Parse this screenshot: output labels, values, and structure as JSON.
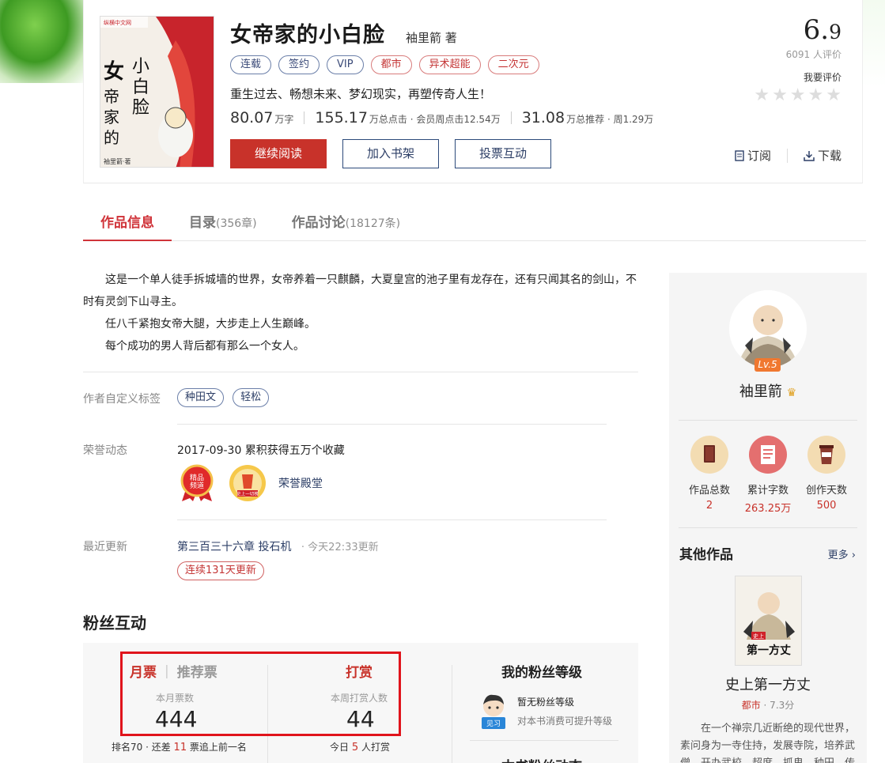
{
  "book": {
    "title": "女帝家的小白脸",
    "author_line": "袖里箭 著",
    "cover_publisher": "纵横中文网",
    "cover_text_main": "女帝家的",
    "cover_text_side": "小白脸",
    "cover_author": "袖里箭·著",
    "tags": [
      "连载",
      "签约",
      "VIP",
      "都市",
      "异术超能",
      "二次元"
    ],
    "intro": "重生过去、畅想未来、梦幻现实，再塑传奇人生！",
    "stats": {
      "words_num": "80.07",
      "words_label": "万字",
      "clicks_num": "155.17",
      "clicks_label": "万总点击 · 会员周点击12.54万",
      "recs_num": "31.08",
      "recs_label": "万总推荐 · 周1.29万"
    },
    "buttons": {
      "continue": "继续阅读",
      "bookshelf": "加入书架",
      "vote": "投票互动"
    },
    "score_int": "6.",
    "score_dec": "9",
    "score_count": "6091 人评价",
    "rate_label": "我要评价",
    "subscribe": "订阅",
    "download": "下载"
  },
  "tabs": [
    {
      "label": "作品信息",
      "count": ""
    },
    {
      "label": "目录",
      "count": "(356章)"
    },
    {
      "label": "作品讨论",
      "count": "(18127条)"
    }
  ],
  "description": [
    "这是一个单人徒手拆城墙的世界，女帝养着一只麒麟，大夏皇宫的池子里有龙存在，还有只闻其名的剑山，不时有灵剑下山寻主。",
    "任八千紧抱女帝大腿，大步走上人生巅峰。",
    "每个成功的男人背后都有那么一个女人。"
  ],
  "custom_tags": {
    "label": "作者自定义标签",
    "items": [
      "种田文",
      "轻松"
    ]
  },
  "honor": {
    "label": "荣誉动态",
    "text": "2017-09-30  累积获得五万个收藏",
    "badge1": "精品频道",
    "badge2": "史上一切榜",
    "hall": "荣誉殿堂"
  },
  "latest": {
    "label": "最近更新",
    "chapter": "第三百三十六章  投石机",
    "time": "· 今天22:33更新",
    "streak": "连续131天更新"
  },
  "fans": {
    "title": "粉丝互动",
    "month_ticket": "月票",
    "rec_ticket": "推荐票",
    "reward": "打赏",
    "month_label": "本月票数",
    "month_value": "444",
    "reward_label": "本周打赏人数",
    "reward_value": "44",
    "rank_prefix": "排名70 · 还差",
    "rank_gap": "11",
    "rank_suffix": "票追上前一名",
    "today_prefix": "今日",
    "today_count": "5",
    "today_suffix": "人打赏",
    "my_level_title": "我的粉丝等级",
    "my_level_name": "暂无粉丝等级",
    "my_level_tip": "对本书消费可提升等级",
    "avatar_badge": "见习",
    "partial_title": "本书粉丝动态"
  },
  "sidebar": {
    "level": "Lv.5",
    "author_name": "袖里箭",
    "stats": [
      {
        "label": "作品总数",
        "value": "2"
      },
      {
        "label": "累计字数",
        "value": "263.25万"
      },
      {
        "label": "创作天数",
        "value": "500"
      }
    ],
    "other_title": "其他作品",
    "more": "更多",
    "other_book_name": "史上第一方丈",
    "other_book_cover_text": "史上第一方丈",
    "other_book_cat": "都市",
    "other_book_score": " · 7.3分",
    "other_book_desc": "在一个禅宗几近断绝的现代世界，素问身为一寺住持，发展寺院，培养武僧，开办武校，超度，抓鬼，种田，传扬佛"
  },
  "colors": {
    "accent": "#c8322a",
    "highlight_frame": "#e0141c",
    "link": "#2c3e66"
  }
}
